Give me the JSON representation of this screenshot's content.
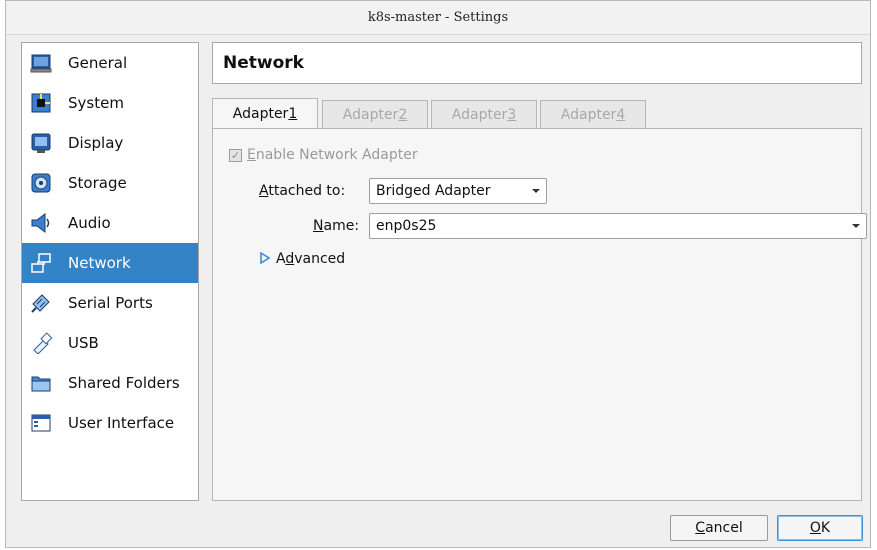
{
  "window": {
    "title": "k8s-master - Settings"
  },
  "sidebar": {
    "items": [
      {
        "label": "General",
        "icon": "monitor-icon",
        "active": false
      },
      {
        "label": "System",
        "icon": "chip-icon",
        "active": false
      },
      {
        "label": "Display",
        "icon": "display-icon",
        "active": false
      },
      {
        "label": "Storage",
        "icon": "storage-icon",
        "active": false
      },
      {
        "label": "Audio",
        "icon": "speaker-icon",
        "active": false
      },
      {
        "label": "Network",
        "icon": "network-icon",
        "active": true
      },
      {
        "label": "Serial Ports",
        "icon": "serial-port-icon",
        "active": false
      },
      {
        "label": "USB",
        "icon": "usb-icon",
        "active": false
      },
      {
        "label": "Shared Folders",
        "icon": "folder-icon",
        "active": false
      },
      {
        "label": "User Interface",
        "icon": "window-icon",
        "active": false
      }
    ]
  },
  "header": {
    "title": "Network"
  },
  "tabs": [
    {
      "pre": "Adapter ",
      "key": "1",
      "active": true
    },
    {
      "pre": "Adapter ",
      "key": "2",
      "active": false
    },
    {
      "pre": "Adapter ",
      "key": "3",
      "active": false
    },
    {
      "pre": "Adapter ",
      "key": "4",
      "active": false
    }
  ],
  "adapter": {
    "enable_key": "E",
    "enable_rest": "nable Network Adapter",
    "enable_checked": true,
    "enable_disabled": true,
    "attached_key": "A",
    "attached_rest": "ttached to:",
    "attached_value": "Bridged Adapter",
    "name_key": "N",
    "name_rest": "ame:",
    "name_value": "enp0s25",
    "advanced_pre": "A",
    "advanced_key": "d",
    "advanced_rest": "vanced"
  },
  "buttons": {
    "cancel_key": "C",
    "cancel_rest": "ancel",
    "ok_key": "O",
    "ok_rest": "K"
  },
  "colors": {
    "selection": "#3483c6",
    "accent_blue": "#3a8ee0"
  }
}
